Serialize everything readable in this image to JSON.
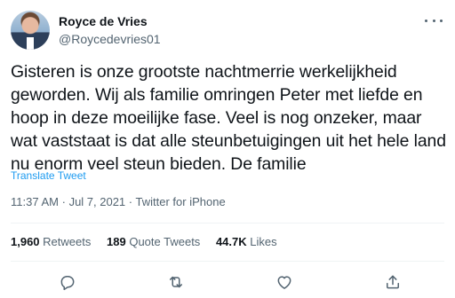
{
  "user": {
    "display_name": "Royce de Vries",
    "handle": "@Roycedevries01"
  },
  "tweet": {
    "text": "Gisteren is onze grootste nachtmerrie werkelijkheid geworden. Wij als familie omringen Peter met liefde en hoop in deze moeilijke fase. Veel is nog onzeker, maar wat vaststaat is dat alle steunbetuigingen uit het hele land nu enorm veel steun bieden. De familie",
    "translate_label": "Translate Tweet",
    "time": "11:37 AM",
    "date": "Jul 7, 2021",
    "source": "Twitter for iPhone",
    "separator": "·"
  },
  "stats": {
    "retweets_count": "1,960",
    "retweets_label": "Retweets",
    "quotes_count": "189",
    "quotes_label": "Quote Tweets",
    "likes_count": "44.7K",
    "likes_label": "Likes"
  },
  "icons": {
    "more": "more-horizontal-icon",
    "reply": "reply-icon",
    "retweet": "retweet-icon",
    "like": "heart-icon",
    "share": "share-icon"
  },
  "colors": {
    "accent": "#1d9bf0",
    "text": "#0f1419",
    "secondary": "#536471"
  }
}
